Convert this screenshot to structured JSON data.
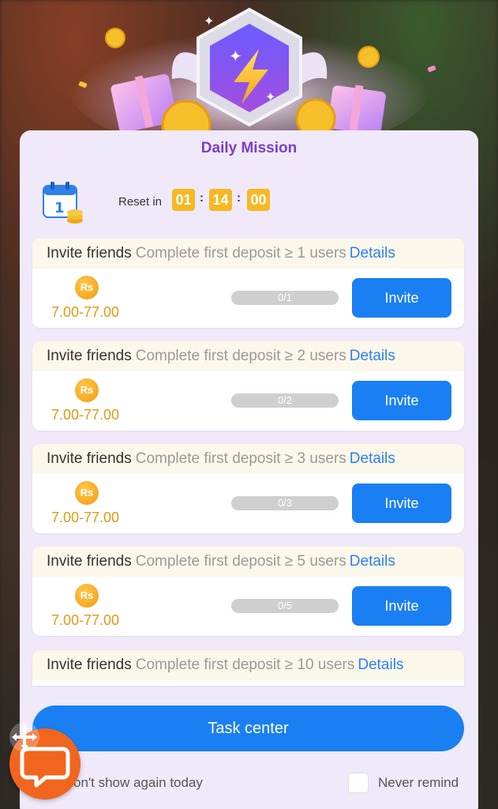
{
  "header": {
    "title": "Daily Mission"
  },
  "reset": {
    "label": "Reset in",
    "hours": "01",
    "minutes": "14",
    "seconds": "00",
    "separator": ":"
  },
  "tasks": [
    {
      "title": "Invite friends",
      "description": "Complete first deposit ≥ 1 users",
      "link": "Details",
      "currency": "Rs",
      "reward": "7.00-77.00",
      "progress_text": "0/1",
      "progress": 0,
      "button": "Invite"
    },
    {
      "title": "Invite friends",
      "description": "Complete first deposit ≥ 2 users",
      "link": "Details",
      "currency": "Rs",
      "reward": "7.00-77.00",
      "progress_text": "0/2",
      "progress": 0,
      "button": "Invite"
    },
    {
      "title": "Invite friends",
      "description": "Complete first deposit ≥ 3 users",
      "link": "Details",
      "currency": "Rs",
      "reward": "7.00-77.00",
      "progress_text": "0/3",
      "progress": 0,
      "button": "Invite"
    },
    {
      "title": "Invite friends",
      "description": "Complete first deposit ≥ 5 users",
      "link": "Details",
      "currency": "Rs",
      "reward": "7.00-77.00",
      "progress_text": "0/5",
      "progress": 0,
      "button": "Invite"
    },
    {
      "title": "Invite friends",
      "description": "Complete first deposit ≥ 10 users",
      "link": "Details"
    }
  ],
  "footer": {
    "task_center": "Task center",
    "dont_show": "on't show again today",
    "never_remind": "Never remind"
  },
  "icons": {
    "banner": "lightning-badge-icon",
    "calendar": "calendar-coins-icon",
    "chat": "chat-support-icon",
    "move": "move-arrows-icon"
  },
  "colors": {
    "accent": "#1a7ff2",
    "title": "#7b3fc4",
    "timer": "#f7b824",
    "reward": "#e09a12",
    "panel": "#f0e9f9",
    "chat": "#f1651f"
  }
}
